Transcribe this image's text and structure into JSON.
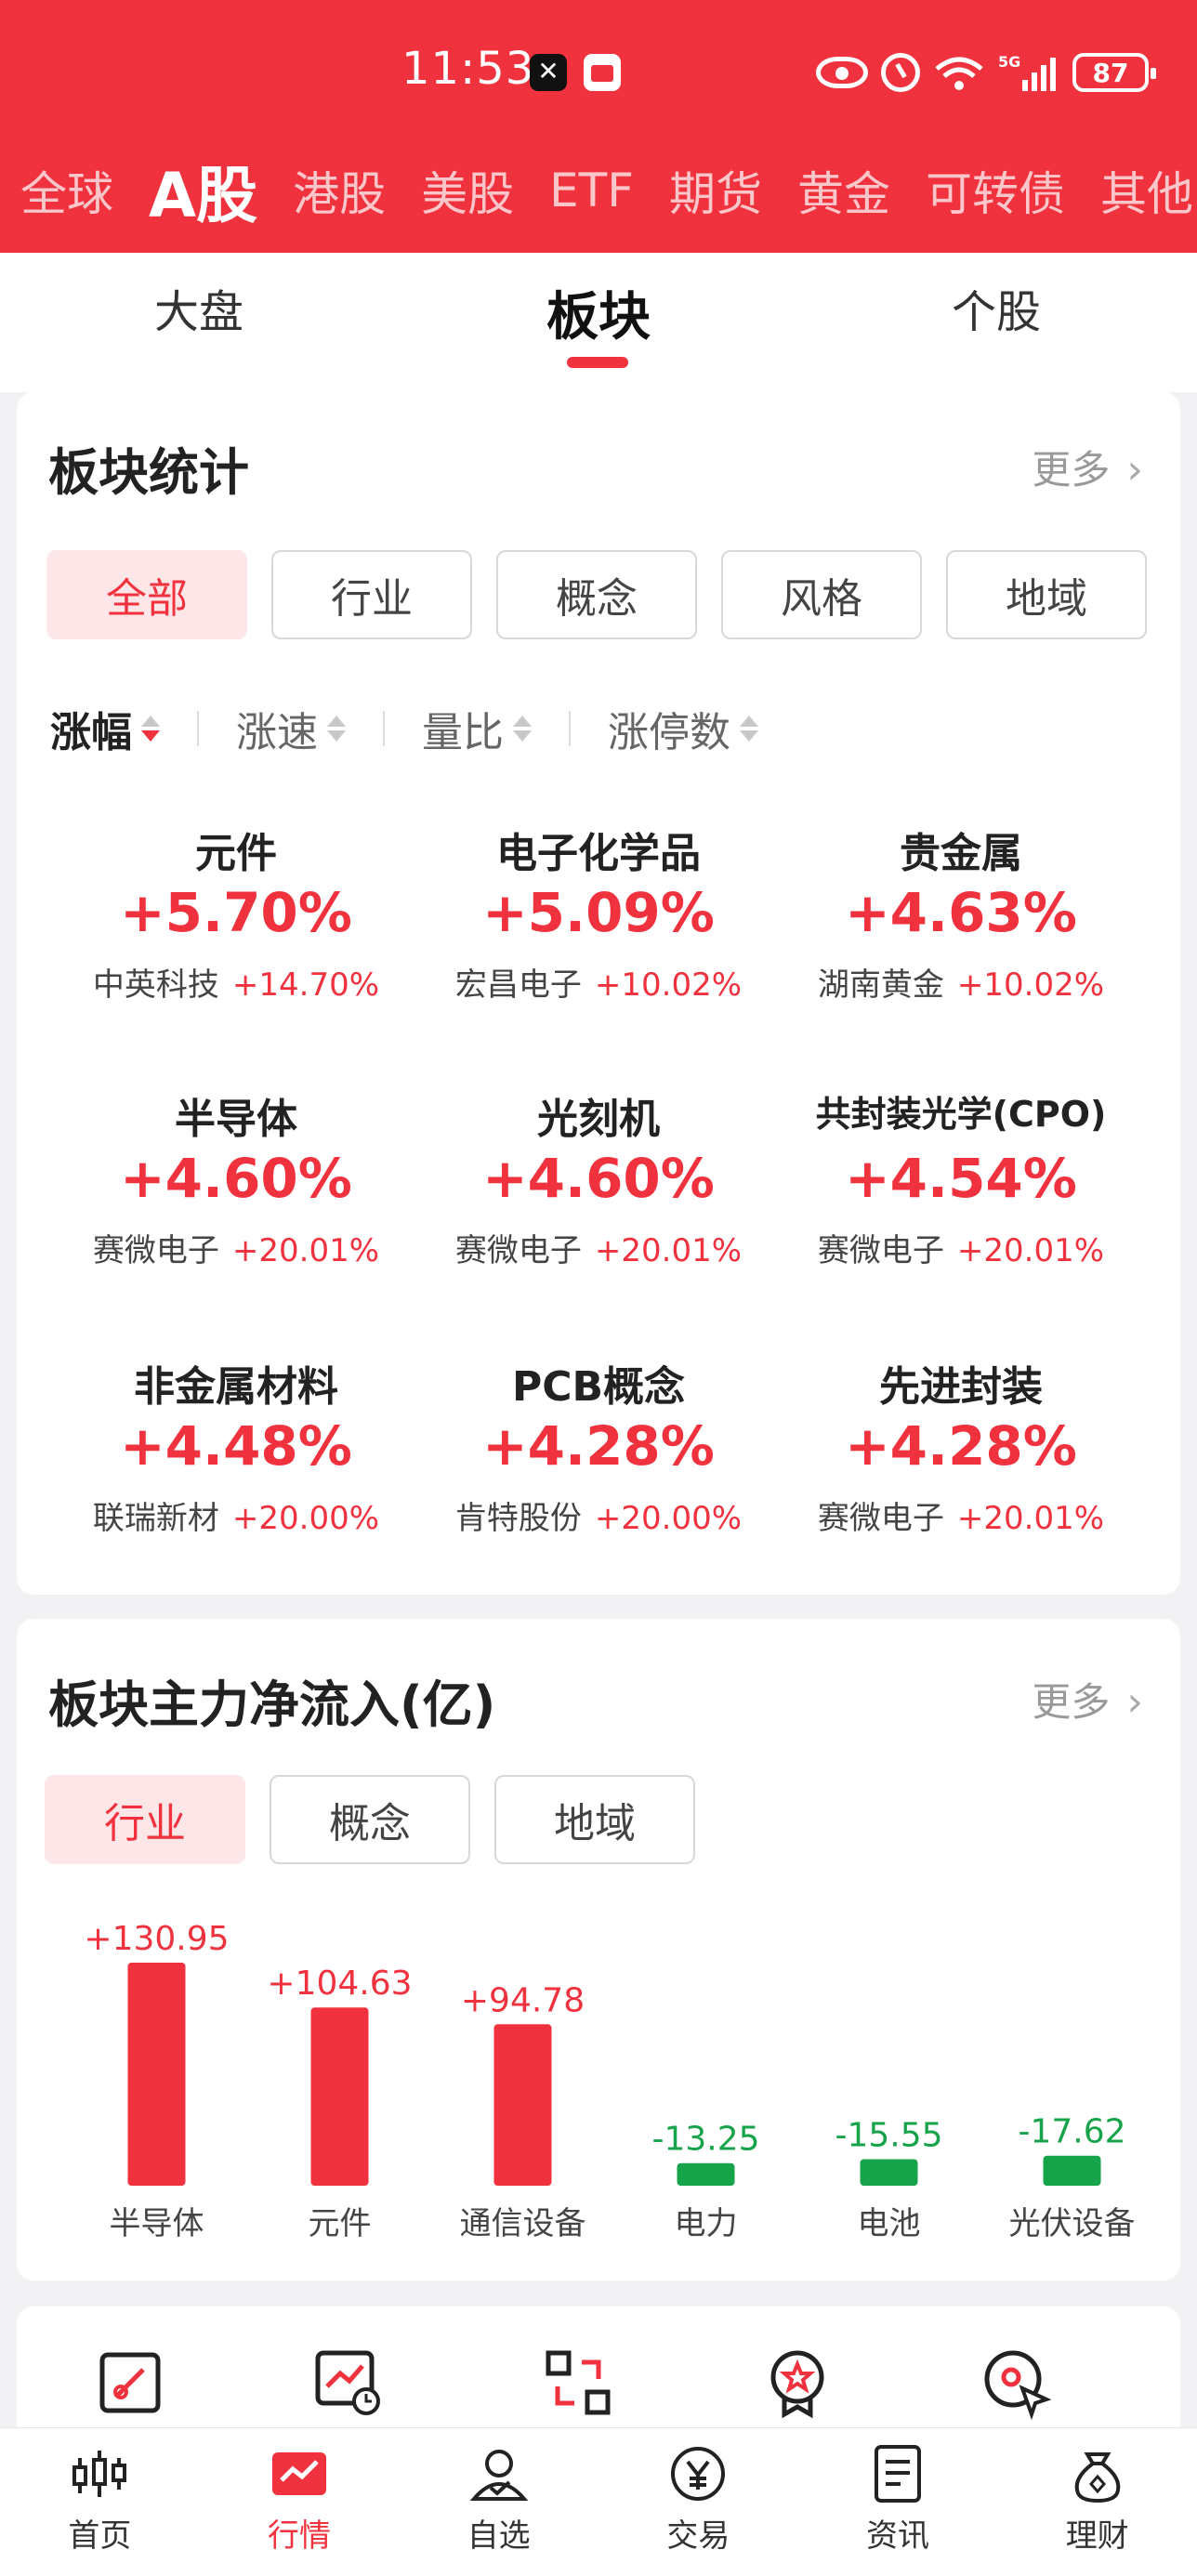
{
  "status_bar": {
    "time": "11:53",
    "battery": "87"
  },
  "market_tabs": [
    "全球",
    "A股",
    "港股",
    "美股",
    "ETF",
    "期货",
    "黄金",
    "可转债",
    "其他"
  ],
  "market_active": "A股",
  "sub_tabs": [
    "大盘",
    "板块",
    "个股"
  ],
  "sub_active": "板块",
  "sector_stats": {
    "title": "板块统计",
    "more": "更多",
    "filters": [
      "全部",
      "行业",
      "概念",
      "风格",
      "地域"
    ],
    "sorts": [
      "涨幅",
      "涨速",
      "量比",
      "涨停数"
    ],
    "items": [
      {
        "name": "元件",
        "pct": "+5.70%",
        "leader": "中英科技",
        "leader_pct": "+14.70%"
      },
      {
        "name": "电子化学品",
        "pct": "+5.09%",
        "leader": "宏昌电子",
        "leader_pct": "+10.02%"
      },
      {
        "name": "贵金属",
        "pct": "+4.63%",
        "leader": "湖南黄金",
        "leader_pct": "+10.02%"
      },
      {
        "name": "半导体",
        "pct": "+4.60%",
        "leader": "赛微电子",
        "leader_pct": "+20.01%"
      },
      {
        "name": "光刻机",
        "pct": "+4.60%",
        "leader": "赛微电子",
        "leader_pct": "+20.01%"
      },
      {
        "name": "共封装光学(CPO)",
        "pct": "+4.54%",
        "leader": "赛微电子",
        "leader_pct": "+20.01%"
      },
      {
        "name": "非金属材料",
        "pct": "+4.48%",
        "leader": "联瑞新材",
        "leader_pct": "+20.00%"
      },
      {
        "name": "PCB概念",
        "pct": "+4.28%",
        "leader": "肯特股份",
        "leader_pct": "+20.00%"
      },
      {
        "name": "先进封装",
        "pct": "+4.28%",
        "leader": "赛微电子",
        "leader_pct": "+20.01%"
      }
    ]
  },
  "net_inflow": {
    "title": "板块主力净流入(亿)",
    "more": "更多",
    "filters": [
      "行业",
      "概念",
      "地域"
    ]
  },
  "chart_data": {
    "type": "bar",
    "categories": [
      "半导体",
      "元件",
      "通信设备",
      "电力",
      "电池",
      "光伏设备"
    ],
    "values": [
      130.95,
      104.63,
      94.78,
      -13.25,
      -15.55,
      -17.62
    ],
    "labels": [
      "+130.95",
      "+104.63",
      "+94.78",
      "-13.25",
      "-15.55",
      "-17.62"
    ],
    "colors": {
      "positive": "#f0323e",
      "negative": "#17a34a"
    }
  },
  "shortcuts": [
    "link-icon",
    "trend-clock-icon",
    "swap-icon",
    "award-icon",
    "search-pointer-icon"
  ],
  "bottom_nav": [
    {
      "label": "首页",
      "icon": "candlestick-icon"
    },
    {
      "label": "行情",
      "icon": "chart-icon"
    },
    {
      "label": "自选",
      "icon": "user-check-icon"
    },
    {
      "label": "交易",
      "icon": "yuan-icon"
    },
    {
      "label": "资讯",
      "icon": "document-icon"
    },
    {
      "label": "理财",
      "icon": "moneybag-icon"
    }
  ],
  "nav_active": "行情",
  "colors": {
    "brand": "#f0323e",
    "up": "#f0323e",
    "down": "#17a34a"
  }
}
